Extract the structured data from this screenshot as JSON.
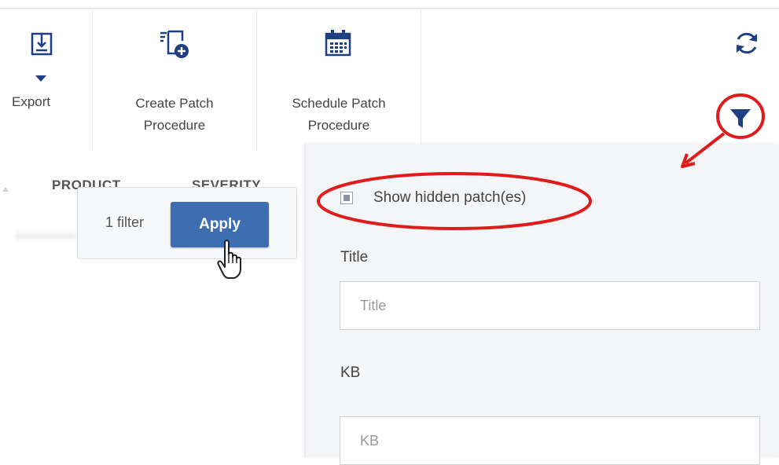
{
  "toolbar": {
    "export_label": "Export",
    "create_patch_label_line1": "Create Patch",
    "create_patch_label_line2": "Procedure",
    "schedule_patch_label_line1": "Schedule Patch",
    "schedule_patch_label_line2": "Procedure"
  },
  "table": {
    "columns": [
      "PRODUCT",
      "SEVERITY"
    ]
  },
  "apply_popup": {
    "filter_count": "1 filter",
    "apply_label": "Apply"
  },
  "filter_panel": {
    "show_hidden_label": "Show hidden patch(es)",
    "show_hidden_checked": true,
    "title_label": "Title",
    "title_placeholder": "Title",
    "kb_label": "KB",
    "kb_placeholder": "KB"
  },
  "colors": {
    "accent_blue": "#3e6db1",
    "callout_red": "#e01b1b",
    "filter_icon_navy": "#1f3f82"
  },
  "icons": {
    "export": "export-icon",
    "export_dropdown": "caret-down-icon",
    "create_patch": "create-procedure-icon",
    "schedule_patch": "calendar-icon",
    "refresh": "refresh-icon",
    "filter": "filter-icon",
    "cursor": "hand-pointer-icon"
  }
}
